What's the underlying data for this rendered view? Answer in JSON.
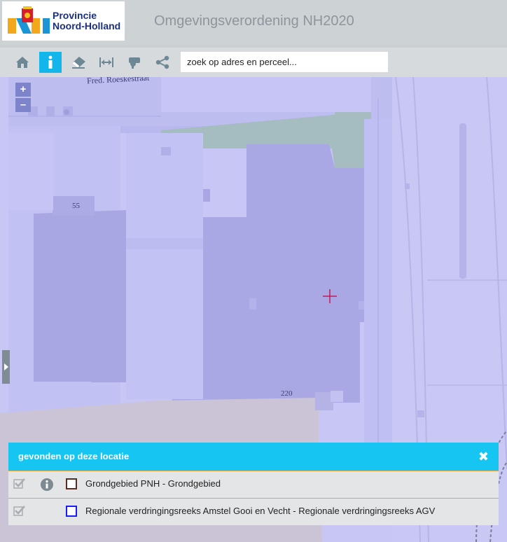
{
  "header": {
    "logo_line1": "Provincie",
    "logo_line2": "Noord-Holland",
    "title": "Omgevingsverordening NH2020"
  },
  "toolbar": {
    "items": [
      {
        "name": "home",
        "icon": "home-icon"
      },
      {
        "name": "info",
        "icon": "info-icon",
        "active": true
      },
      {
        "name": "eraser",
        "icon": "eraser-icon"
      },
      {
        "name": "measure",
        "icon": "measure-icon"
      },
      {
        "name": "location",
        "icon": "location-icon"
      },
      {
        "name": "share",
        "icon": "share-icon"
      }
    ],
    "search_placeholder": "zoek op adres en perceel..."
  },
  "map": {
    "street_label": "Fred. Roeskestraat",
    "house_numbers": [
      "55",
      "220"
    ],
    "zoom_in": "+",
    "zoom_out": "–"
  },
  "results": {
    "title": "gevonden op deze locatie",
    "close": "✖",
    "rows": [
      {
        "label": "Grondgebied PNH - Grondgebied",
        "swatch_color": "#5b2d22",
        "has_info": true
      },
      {
        "label": "Regionale verdringingsreeks Amstel Gooi en Vecht - Regionale verdringingsreeks AGV",
        "swatch_color": "#1a1aff",
        "has_info": false
      }
    ]
  }
}
